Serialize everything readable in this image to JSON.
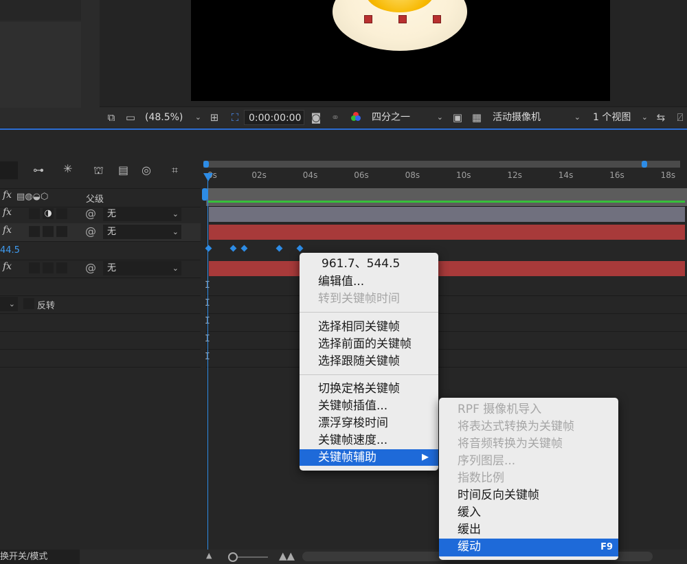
{
  "viewer_toolbar": {
    "zoom": "(48.5%)",
    "timecode": "0:00:00:00",
    "resolution": "四分之一",
    "camera": "活动摄像机",
    "views": "1 个视图"
  },
  "timeline": {
    "ticks": [
      "0s",
      "02s",
      "04s",
      "06s",
      "08s",
      "10s",
      "12s",
      "14s",
      "16s",
      "18s"
    ],
    "header_parent": "父级",
    "value_fragment": "44.5",
    "invert_label": "反转",
    "layers": [
      {
        "parent": "无"
      },
      {
        "parent": "无"
      },
      {
        "parent": "无"
      }
    ],
    "bottom_toggle": "换开关/模式"
  },
  "context_menu": {
    "value": "961.7、544.5",
    "items": [
      {
        "label": "编辑值...",
        "enabled": true
      },
      {
        "label": "转到关键帧时间",
        "enabled": false
      },
      {
        "label": "选择相同关键帧",
        "enabled": true
      },
      {
        "label": "选择前面的关键帧",
        "enabled": true
      },
      {
        "label": "选择跟随关键帧",
        "enabled": true
      },
      {
        "label": "切换定格关键帧",
        "enabled": true
      },
      {
        "label": "关键帧插值...",
        "enabled": true
      },
      {
        "label": "漂浮穿梭时间",
        "enabled": true
      },
      {
        "label": "关键帧速度...",
        "enabled": true
      },
      {
        "label": "关键帧辅助",
        "enabled": true,
        "submenu": "▶"
      }
    ]
  },
  "submenu": {
    "items": [
      {
        "label": "RPF 摄像机导入",
        "enabled": false
      },
      {
        "label": "将表达式转换为关键帧",
        "enabled": false
      },
      {
        "label": "将音频转换为关键帧",
        "enabled": false
      },
      {
        "label": "序列图层...",
        "enabled": false
      },
      {
        "label": "指数比例",
        "enabled": false
      },
      {
        "label": "时间反向关键帧",
        "enabled": true
      },
      {
        "label": "缓入",
        "enabled": true
      },
      {
        "label": "缓出",
        "enabled": true
      },
      {
        "label": "缓动",
        "enabled": true,
        "shortcut": "F9"
      }
    ]
  },
  "colors": {
    "accent": "#1e6ad9",
    "playhead": "#2d8ce6",
    "layer_red": "#a83a3a",
    "layer_gray": "#6f6f7f",
    "green_bar": "#36c13a"
  }
}
